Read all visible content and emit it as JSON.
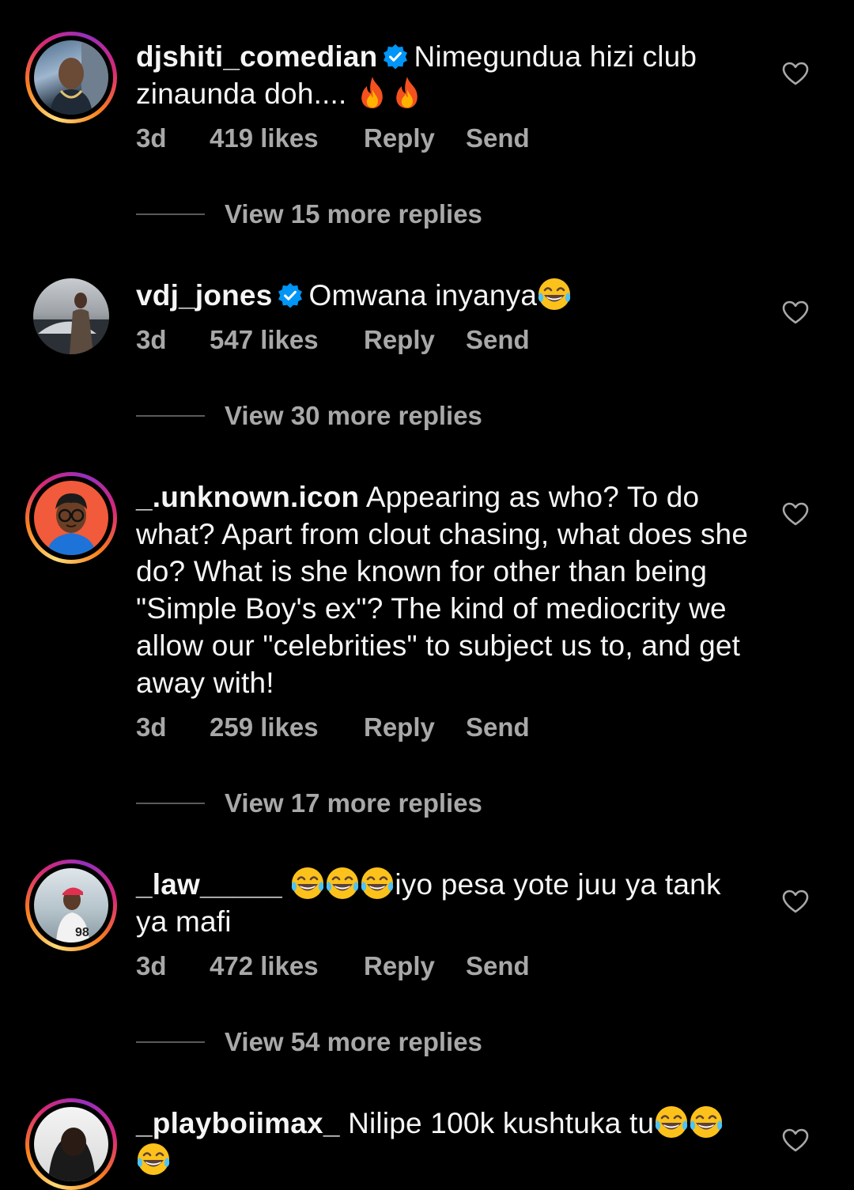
{
  "comments": [
    {
      "username": "djshiti_comedian",
      "verified": true,
      "text": "Nimegundua hizi club zinaunda doh.... ",
      "emoji_suffix": [
        "fire-emoji",
        "fire-emoji"
      ],
      "time": "3d",
      "likes": "419 likes",
      "reply": "Reply",
      "send": "Send",
      "view_replies": "View 15 more replies"
    },
    {
      "username": "vdj_jones",
      "verified": true,
      "text": "Omwana inyanya",
      "emoji_suffix": [
        "laughing-tears-emoji"
      ],
      "time": "3d",
      "likes": "547 likes",
      "reply": "Reply",
      "send": "Send",
      "view_replies": "View 30 more replies"
    },
    {
      "username": "_.unknown.icon",
      "verified": false,
      "text": "Appearing as who? To do what? Apart from clout chasing, what does she do? What is she known for other than being \"Simple Boy's ex\"? The kind of mediocrity we allow our \"celebrities\" to subject us to, and get away with!",
      "time": "3d",
      "likes": "259 likes",
      "reply": "Reply",
      "send": "Send",
      "view_replies": "View 17 more replies"
    },
    {
      "username": "_law_____",
      "verified": false,
      "text_after_emoji": "iyo pesa yote juu ya tank ya mafi",
      "emoji_prefix": [
        "laughing-tears-emoji",
        "laughing-tears-emoji",
        "laughing-tears-emoji"
      ],
      "time": "3d",
      "likes": "472 likes",
      "reply": "Reply",
      "send": "Send",
      "view_replies": "View 54 more replies"
    },
    {
      "username": "_playboiimax_",
      "verified": false,
      "text": "Nilipe 100k kushtuka tu",
      "emoji_suffix": [
        "laughing-tears-emoji",
        "laughing-tears-emoji",
        "laughing-tears-emoji"
      ]
    }
  ],
  "colors": {
    "background": "#000000",
    "text": "#f5f5f5",
    "meta": "#a8a8a8",
    "verified_badge": "#0095f6"
  }
}
